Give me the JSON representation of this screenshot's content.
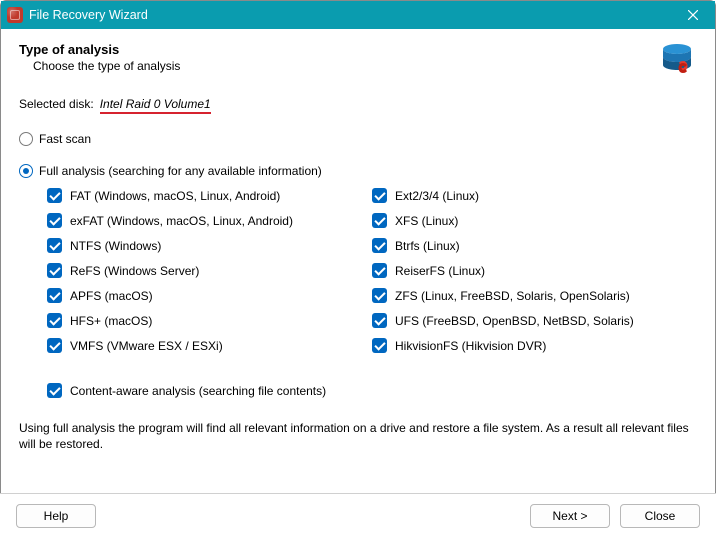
{
  "window": {
    "title": "File Recovery Wizard"
  },
  "header": {
    "title": "Type of analysis",
    "subtitle": "Choose the type of analysis"
  },
  "selected_disk": {
    "label": "Selected disk:",
    "value": "Intel Raid 0 Volume1"
  },
  "options": {
    "fast_scan": {
      "label": "Fast scan",
      "selected": false
    },
    "full_analysis": {
      "label": "Full analysis (searching for any available information)",
      "selected": true
    }
  },
  "filesystems": {
    "left": [
      {
        "label": "FAT (Windows, macOS, Linux, Android)",
        "checked": true
      },
      {
        "label": "exFAT (Windows, macOS, Linux, Android)",
        "checked": true
      },
      {
        "label": "NTFS (Windows)",
        "checked": true
      },
      {
        "label": "ReFS (Windows Server)",
        "checked": true
      },
      {
        "label": "APFS (macOS)",
        "checked": true
      },
      {
        "label": "HFS+ (macOS)",
        "checked": true
      },
      {
        "label": "VMFS (VMware ESX / ESXi)",
        "checked": true
      }
    ],
    "right": [
      {
        "label": "Ext2/3/4 (Linux)",
        "checked": true
      },
      {
        "label": "XFS (Linux)",
        "checked": true
      },
      {
        "label": "Btrfs (Linux)",
        "checked": true
      },
      {
        "label": "ReiserFS (Linux)",
        "checked": true
      },
      {
        "label": "ZFS (Linux, FreeBSD, Solaris, OpenSolaris)",
        "checked": true
      },
      {
        "label": "UFS (FreeBSD, OpenBSD, NetBSD, Solaris)",
        "checked": true
      },
      {
        "label": "HikvisionFS (Hikvision DVR)",
        "checked": true
      }
    ]
  },
  "content_aware": {
    "label": "Content-aware analysis (searching file contents)",
    "checked": true
  },
  "footer_note": "Using full analysis the program will find all relevant information on a drive and restore a file system. As a result all relevant files will be restored.",
  "buttons": {
    "help": "Help",
    "next": "Next >",
    "close": "Close"
  }
}
